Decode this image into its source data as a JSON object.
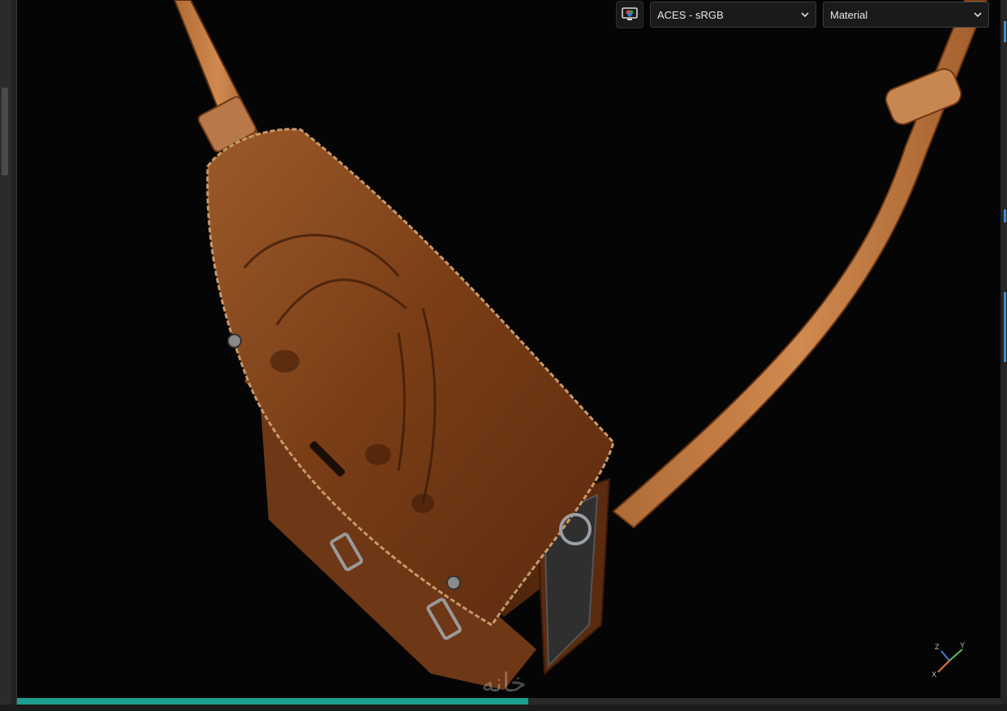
{
  "toolbar": {
    "display_icon": "monitor-color-icon",
    "color_space": "ACES - sRGB",
    "render_mode": "Material"
  },
  "viewport": {
    "subject": "leather-satchel-3d-model",
    "axis_labels": {
      "z": "Z",
      "y": "Y",
      "x": "X"
    },
    "watermark": "خانه"
  },
  "progress": {
    "value": 0.52
  },
  "colors": {
    "viewport_bg": "#050505",
    "progress_fill": "#1b9e8f",
    "panel_accent": "#3d8fd6",
    "leather": "#8a4a1f"
  }
}
